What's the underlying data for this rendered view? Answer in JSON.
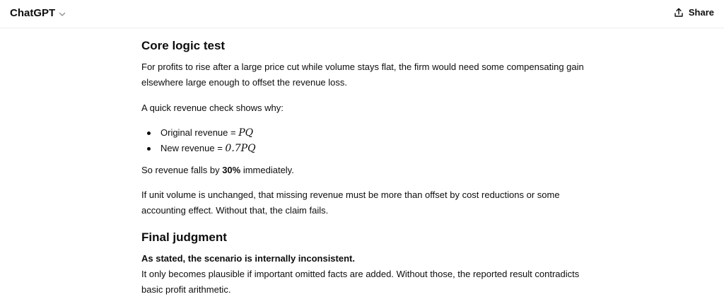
{
  "header": {
    "model_name": "ChatGPT",
    "share_label": "Share"
  },
  "message": {
    "section1_heading": "Core logic test",
    "para1": "For profits to rise after a large price cut while volume stays flat, the firm would need some compensating gain elsewhere large enough to offset the revenue loss.",
    "para2": "A quick revenue check shows why:",
    "bullets": [
      {
        "label": "Original revenue = ",
        "formula": "PQ"
      },
      {
        "label": "New revenue = ",
        "formula": "0.7PQ"
      }
    ],
    "para3_prefix": "So revenue falls by ",
    "para3_bold": "30%",
    "para3_suffix": " immediately.",
    "para4": "If unit volume is unchanged, that missing revenue must be more than offset by cost reductions or some accounting effect. Without that, the claim fails.",
    "section2_heading": "Final judgment",
    "verdict_bold": "As stated, the scenario is internally inconsistent.",
    "verdict_text": "It only becomes plausible if important omitted facts are added. Without those, the reported result contradicts basic profit arithmetic."
  }
}
